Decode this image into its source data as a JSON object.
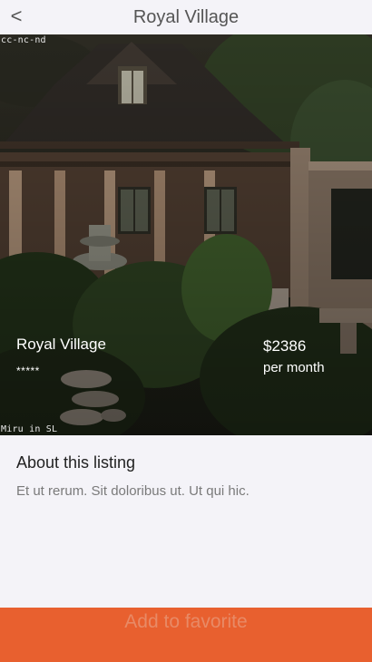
{
  "header": {
    "back_label": "<",
    "title": "Royal Village"
  },
  "hero": {
    "watermark_top": "cc-nc-nd",
    "watermark_bottom": "Miru in SL",
    "name": "Royal Village",
    "rating": "*****",
    "price": "$2386",
    "period": "per month"
  },
  "about": {
    "title": "About this listing",
    "text": "Et ut rerum. Sit doloribus ut. Ut qui hic."
  },
  "actions": {
    "favorite_label": "Add to favorite"
  },
  "colors": {
    "accent": "#e8602f",
    "background": "#f4f3f8"
  }
}
